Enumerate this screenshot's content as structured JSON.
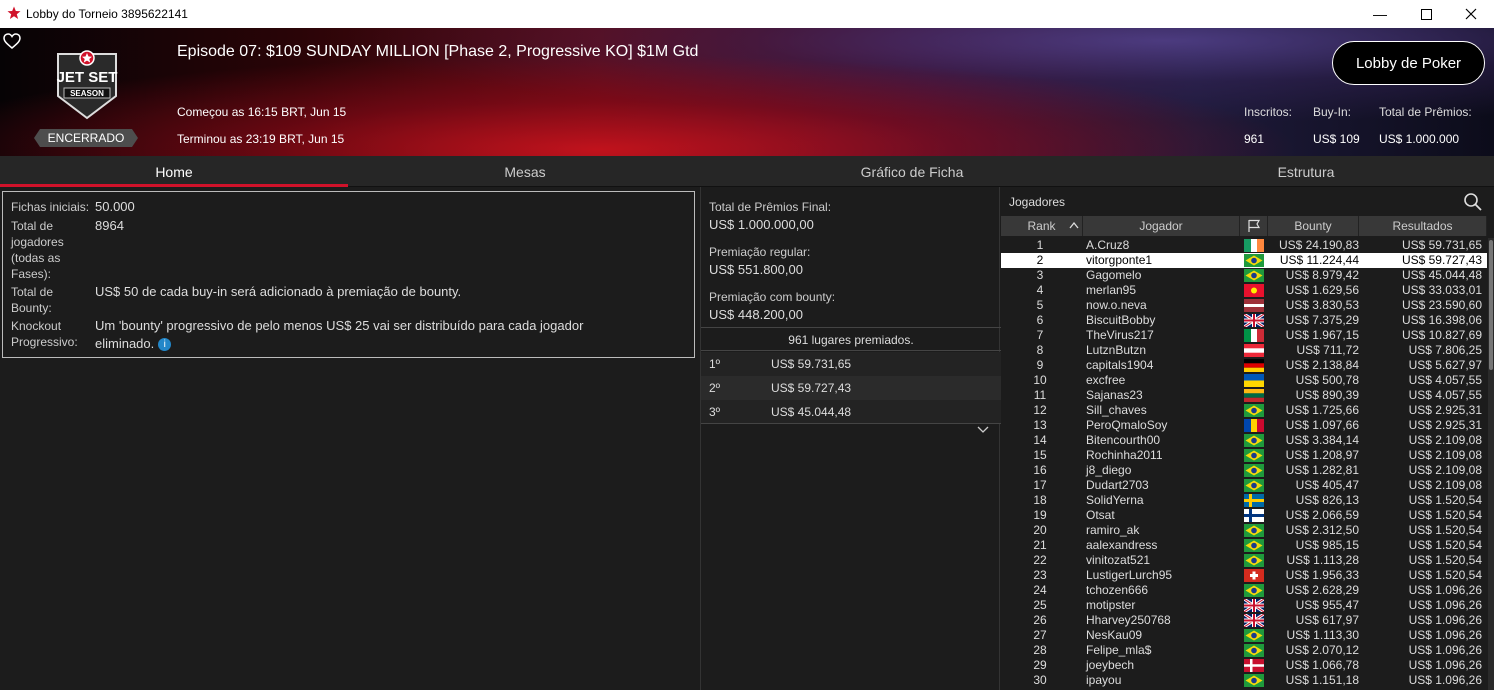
{
  "window": {
    "title": "Lobby do Torneio 3895622141"
  },
  "header": {
    "title": "Episode 07: $109 SUNDAY MILLION [Phase 2, Progressive KO] $1M Gtd",
    "started": "Começou as 16:15 BRT, Jun 15",
    "ended": "Terminou as 23:19 BRT, Jun 15",
    "status_badge": "ENCERRADO",
    "logo": {
      "line1": "JET SET",
      "line2": "SEASON"
    },
    "lobby_button": "Lobby de Poker",
    "stats": {
      "registered_label": "Inscritos:",
      "registered_value": "961",
      "buyin_label": "Buy-In:",
      "buyin_value": "US$ 109",
      "prize_label": "Total de Prêmios:",
      "prize_value": "US$ 1.000.000"
    }
  },
  "tabs": [
    "Home",
    "Mesas",
    "Gráfico de Ficha",
    "Estrutura"
  ],
  "info": {
    "starting_chips_label": "Fichas iniciais:",
    "starting_chips_value": "50.000",
    "total_players_label": "Total de jogadores (todas as Fases):",
    "total_players_value": "8964",
    "total_bounty_label": "Total de Bounty:",
    "total_bounty_value": "US$ 50 de cada buy-in será adicionado à premiação de bounty.",
    "pko_label": "Knockout Progressivo:",
    "pko_value": "Um 'bounty' progressivo de pelo menos US$ 25 vai ser distribuído para cada jogador eliminado."
  },
  "prizes": {
    "final_label": "Total de Prêmios Final:",
    "final_value": "US$ 1.000.000,00",
    "regular_label": "Premiação regular:",
    "regular_value": "US$ 551.800,00",
    "bounty_label": "Premiação com bounty:",
    "bounty_value": "US$ 448.200,00",
    "places_text": "961 lugares premiados.",
    "payouts": [
      {
        "pos": "1º",
        "amount": "US$ 59.731,65"
      },
      {
        "pos": "2º",
        "amount": "US$ 59.727,43"
      },
      {
        "pos": "3º",
        "amount": "US$ 45.044,48"
      }
    ]
  },
  "players_panel": {
    "title": "Jogadores",
    "columns": {
      "rank": "Rank",
      "player": "Jogador",
      "bounty": "Bounty",
      "results": "Resultados"
    },
    "selected_rank": "2",
    "rows": [
      {
        "rank": "1",
        "name": "A.Cruz8",
        "flag": "flag-ireland",
        "bounty": "US$ 24.190,83",
        "result": "US$ 59.731,65"
      },
      {
        "rank": "2",
        "name": "vitorgponte1",
        "flag": "flag-brazil",
        "bounty": "US$ 11.224,44",
        "result": "US$ 59.727,43"
      },
      {
        "rank": "3",
        "name": "Gagomelo",
        "flag": "flag-brazil",
        "bounty": "US$ 8.979,42",
        "result": "US$ 45.044,48"
      },
      {
        "rank": "4",
        "name": "merlan95",
        "flag": "flag-kyrgyzstan",
        "bounty": "US$ 1.629,56",
        "result": "US$ 33.033,01"
      },
      {
        "rank": "5",
        "name": "now.o.neva",
        "flag": "flag-latvia",
        "bounty": "US$ 3.830,53",
        "result": "US$ 23.590,60"
      },
      {
        "rank": "6",
        "name": "BiscuitBobby",
        "flag": "flag-uk",
        "bounty": "US$ 7.375,29",
        "result": "US$ 16.398,06"
      },
      {
        "rank": "7",
        "name": "TheVirus217",
        "flag": "flag-italy",
        "bounty": "US$ 1.967,15",
        "result": "US$ 10.827,69"
      },
      {
        "rank": "8",
        "name": "LutznButzn",
        "flag": "flag-austria",
        "bounty": "US$ 711,72",
        "result": "US$ 7.806,25"
      },
      {
        "rank": "9",
        "name": "capitals1904",
        "flag": "flag-germany",
        "bounty": "US$ 2.138,84",
        "result": "US$ 5.627,97"
      },
      {
        "rank": "10",
        "name": "excfree",
        "flag": "flag-ukraine",
        "bounty": "US$ 500,78",
        "result": "US$ 4.057,55"
      },
      {
        "rank": "11",
        "name": "Sajanas23",
        "flag": "flag-lithuania",
        "bounty": "US$ 890,39",
        "result": "US$ 4.057,55"
      },
      {
        "rank": "12",
        "name": "Sill_chaves",
        "flag": "flag-brazil",
        "bounty": "US$ 1.725,66",
        "result": "US$ 2.925,31"
      },
      {
        "rank": "13",
        "name": "PeroQmaloSoy",
        "flag": "flag-moldova",
        "bounty": "US$ 1.097,66",
        "result": "US$ 2.925,31"
      },
      {
        "rank": "14",
        "name": "Bitencourth00",
        "flag": "flag-brazil",
        "bounty": "US$ 3.384,14",
        "result": "US$ 2.109,08"
      },
      {
        "rank": "15",
        "name": "Rochinha2011",
        "flag": "flag-brazil",
        "bounty": "US$ 1.208,97",
        "result": "US$ 2.109,08"
      },
      {
        "rank": "16",
        "name": "j8_diego",
        "flag": "flag-brazil",
        "bounty": "US$ 1.282,81",
        "result": "US$ 2.109,08"
      },
      {
        "rank": "17",
        "name": "Dudart2703",
        "flag": "flag-brazil",
        "bounty": "US$ 405,47",
        "result": "US$ 2.109,08"
      },
      {
        "rank": "18",
        "name": "SolidYerna",
        "flag": "flag-sweden",
        "bounty": "US$ 826,13",
        "result": "US$ 1.520,54"
      },
      {
        "rank": "19",
        "name": "Otsat",
        "flag": "flag-finland",
        "bounty": "US$ 2.066,59",
        "result": "US$ 1.520,54"
      },
      {
        "rank": "20",
        "name": "ramiro_ak",
        "flag": "flag-brazil",
        "bounty": "US$ 2.312,50",
        "result": "US$ 1.520,54"
      },
      {
        "rank": "21",
        "name": "aalexandress",
        "flag": "flag-brazil",
        "bounty": "US$ 985,15",
        "result": "US$ 1.520,54"
      },
      {
        "rank": "22",
        "name": "vinitozat521",
        "flag": "flag-brazil",
        "bounty": "US$ 1.113,28",
        "result": "US$ 1.520,54"
      },
      {
        "rank": "23",
        "name": "LustigerLurch95",
        "flag": "flag-switzerland",
        "bounty": "US$ 1.956,33",
        "result": "US$ 1.520,54"
      },
      {
        "rank": "24",
        "name": "tchozen666",
        "flag": "flag-brazil",
        "bounty": "US$ 2.628,29",
        "result": "US$ 1.096,26"
      },
      {
        "rank": "25",
        "name": "motipster",
        "flag": "flag-uk",
        "bounty": "US$ 955,47",
        "result": "US$ 1.096,26"
      },
      {
        "rank": "26",
        "name": "Hharvey250768",
        "flag": "flag-uk",
        "bounty": "US$ 617,97",
        "result": "US$ 1.096,26"
      },
      {
        "rank": "27",
        "name": "NesKau09",
        "flag": "flag-brazil",
        "bounty": "US$ 1.113,30",
        "result": "US$ 1.096,26"
      },
      {
        "rank": "28",
        "name": "Felipe_mla$",
        "flag": "flag-brazil",
        "bounty": "US$ 2.070,12",
        "result": "US$ 1.096,26"
      },
      {
        "rank": "29",
        "name": "joeybech",
        "flag": "flag-denmark",
        "bounty": "US$ 1.066,78",
        "result": "US$ 1.096,26"
      },
      {
        "rank": "30",
        "name": "ipayou",
        "flag": "flag-brazil",
        "bounty": "US$ 1.151,18",
        "result": "US$ 1.096,26"
      }
    ]
  },
  "colors": {
    "accent": "#d0122a",
    "info_icon": "#2287c9",
    "selected_row": "#ffffff"
  }
}
